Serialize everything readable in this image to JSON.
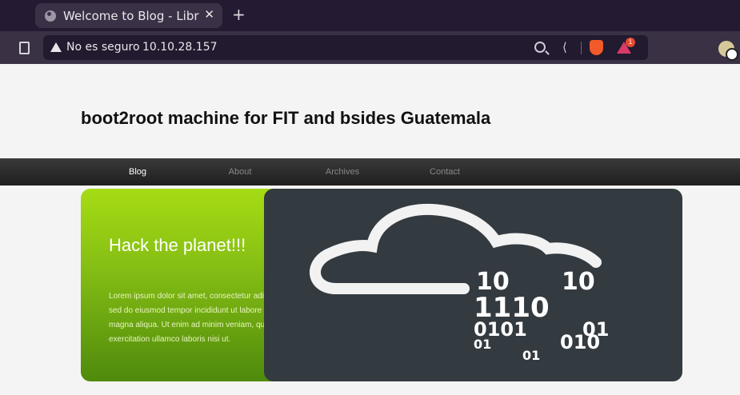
{
  "browser": {
    "tab_title": "Welcome to Blog - Library Machine",
    "tab_close": "✕",
    "new_tab": "+",
    "security_label": "No es seguro",
    "url": "10.10.28.157",
    "rewards_badge": "1"
  },
  "site": {
    "title": "boot2root machine for FIT and bsides Guatemala",
    "nav": [
      "Blog",
      "About",
      "Archives",
      "Contact"
    ]
  },
  "hero": {
    "heading": "Hack the planet!!!",
    "body": "Lorem ipsum dolor sit amet, consectetur adipisicing elit, sed do eiusmod tempor incididunt ut labore et dolore magna aliqua. Ut enim ad minim veniam, quis nostrud exercitation ullamco laboris nisi ut.",
    "binary_rows": [
      "10",
      "10",
      "1110",
      "0101",
      "01",
      "01",
      "010",
      "01"
    ]
  }
}
